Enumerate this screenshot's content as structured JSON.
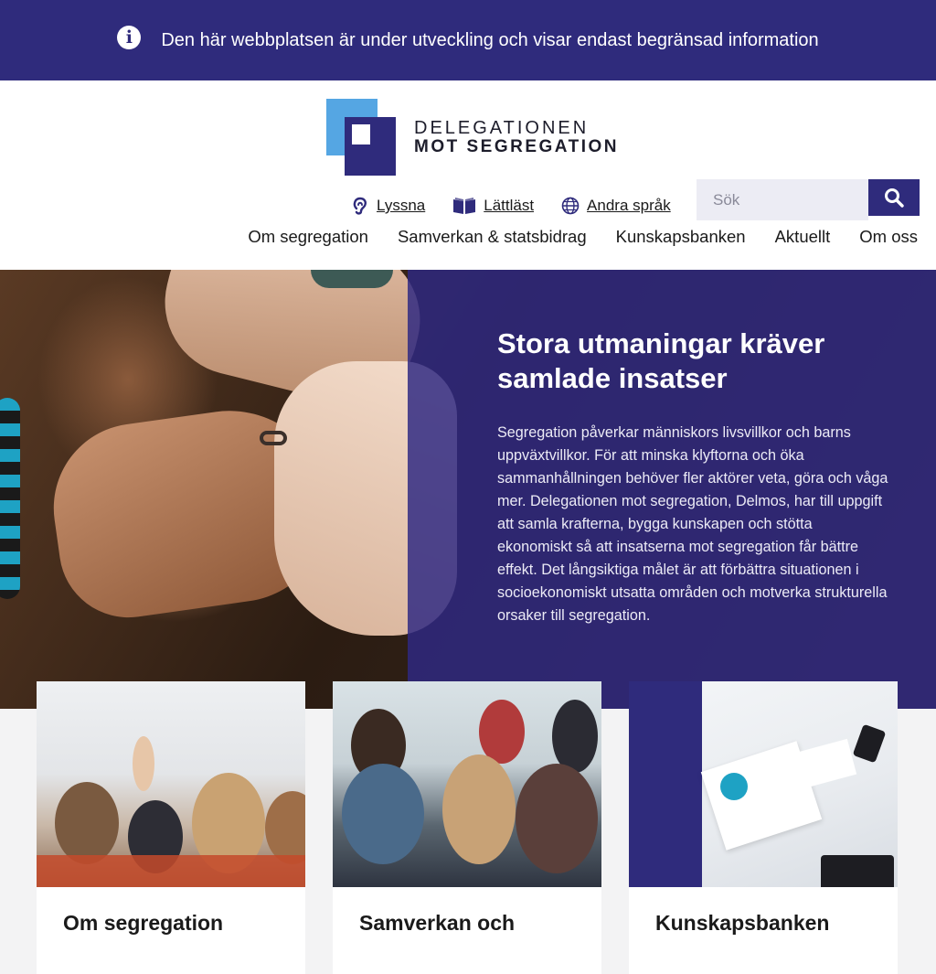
{
  "banner": {
    "icon": "info-circle-icon",
    "text": "Den här webbplatsen är under utveckling och visar endast begränsad information"
  },
  "logo": {
    "line1": "DELEGATIONEN",
    "line2": "MOT SEGREGATION",
    "colors": {
      "light": "#55a6e3",
      "dark": "#2f2b7c"
    }
  },
  "tools": {
    "listen": {
      "label": "Lyssna",
      "icon": "ear-icon"
    },
    "easy_read": {
      "label": "Lättläst",
      "icon": "book-icon"
    },
    "languages": {
      "label": "Andra språk",
      "icon": "globe-icon"
    }
  },
  "search": {
    "placeholder": "Sök",
    "icon": "search-icon"
  },
  "nav": {
    "items": [
      {
        "label": "Om segregation"
      },
      {
        "label": "Samverkan & statsbidrag"
      },
      {
        "label": "Kunskapsbanken"
      },
      {
        "label": "Aktuellt"
      },
      {
        "label": "Om oss"
      }
    ]
  },
  "hero": {
    "title": "Stora utmaningar kräver samlade insatser",
    "body": "Segregation påverkar människors livsvillkor och barns uppväxtvillkor. För att minska klyftorna och öka sammanhållningen behöver fler aktörer veta, göra och våga mer. Delegationen mot segregation, Delmos, har till uppgift att samla krafterna, bygga kunskapen och stötta ekonomiskt så att insatserna mot segregation får bättre effekt. Det långsiktiga målet är att förbättra situationen i socioekonomiskt utsatta områden och motverka strukturella orsaker till segregation."
  },
  "cards": [
    {
      "title": "Om segregation"
    },
    {
      "title": "Samverkan och"
    },
    {
      "title": "Kunskapsbanken"
    }
  ],
  "colors": {
    "brand": "#2f2b7c",
    "accent": "#55a6e3"
  }
}
